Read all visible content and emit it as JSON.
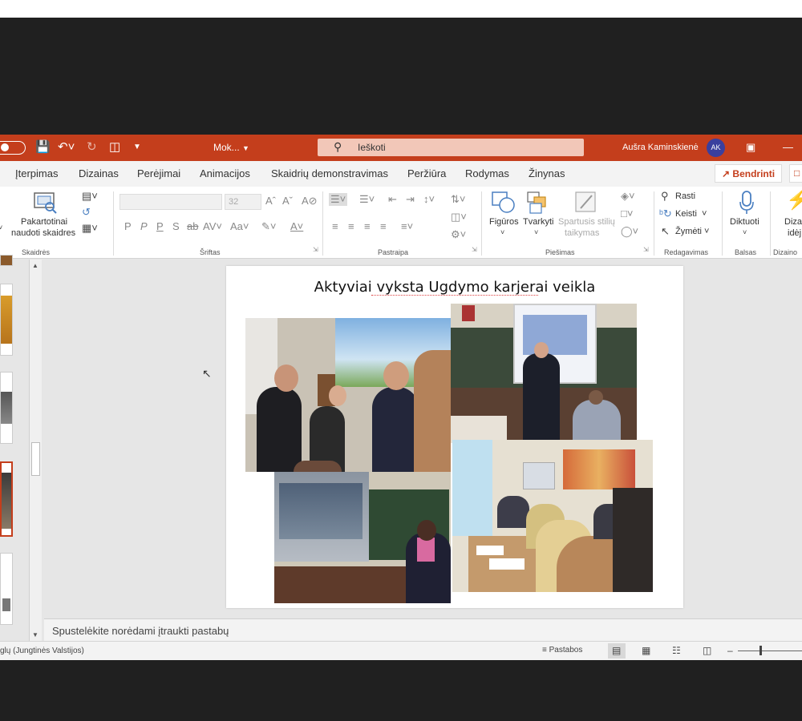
{
  "titlebar": {
    "file_name": "Mok...",
    "search_placeholder": "Ieškoti",
    "user_name": "Aušra Kaminskienė",
    "user_initials": "AK"
  },
  "tabs": [
    "Įterpimas",
    "Dizainas",
    "Perėjimai",
    "Animacijos",
    "Skaidrių demonstravimas",
    "Peržiūra",
    "Rodymas",
    "Žinynas"
  ],
  "share_label": "Bendrinti",
  "ribbon": {
    "slides_group": {
      "reuse_line1": "Pakartotinai",
      "reuse_line2": "naudoti skaidres",
      "label": "Skaidrės"
    },
    "font_group": {
      "size": "32",
      "label": "Šriftas"
    },
    "paragraph_group": {
      "label": "Pastraipa"
    },
    "drawing_group": {
      "shapes": "Figūros",
      "arrange": "Tvarkyti",
      "quick_styles_line1": "Spartusis stilių",
      "quick_styles_line2": "taikymas",
      "label": "Piešimas"
    },
    "editing_group": {
      "find": "Rasti",
      "replace": "Keisti",
      "select": "Žymėti",
      "label": "Redagavimas"
    },
    "voice_group": {
      "dictate": "Diktuoti",
      "label": "Balsas"
    },
    "designer_group": {
      "ideas_line1": "Dizai",
      "ideas_line2": "idėj",
      "label": "Dizaino"
    }
  },
  "slide": {
    "title": "Aktyviai vyksta Ugdymo karjerai veikla"
  },
  "notes_placeholder": "Spustelėkite norėdami įtraukti pastabų",
  "status": {
    "language": "glų (Jungtinės Valstijos)",
    "notes_button": "Pastabos"
  },
  "colors": {
    "accent": "#c43e1c",
    "search_bg": "#f2c7b8",
    "avatar": "#3a3f9e"
  }
}
